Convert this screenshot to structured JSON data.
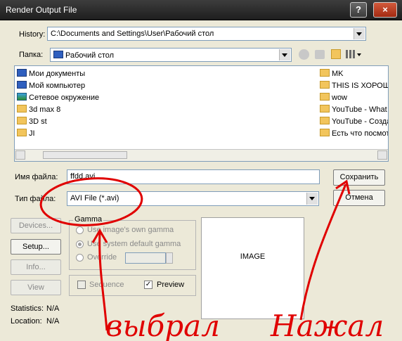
{
  "window": {
    "title": "Render Output File",
    "help_label": "?",
    "close_label": "×"
  },
  "history": {
    "label": "History:",
    "value": "C:\\Documents and Settings\\User\\Рабочий стол"
  },
  "folder": {
    "label": "Папка:",
    "value": "Рабочий стол"
  },
  "files": {
    "left": [
      {
        "label": "Мои документы",
        "icon": "documents-icon"
      },
      {
        "label": "Мой компьютер",
        "icon": "computer-icon"
      },
      {
        "label": "Сетевое окружение",
        "icon": "network-icon"
      },
      {
        "label": "3d max 8",
        "icon": "folder-icon"
      },
      {
        "label": "3D st",
        "icon": "folder-icon"
      },
      {
        "label": "JI",
        "icon": "folder-icon"
      }
    ],
    "right": [
      {
        "label": "MK",
        "icon": "folder-icon"
      },
      {
        "label": "THIS IS ХОРОШО",
        "icon": "folder-icon"
      },
      {
        "label": "wow",
        "icon": "folder-icon"
      },
      {
        "label": "YouTube - What",
        "icon": "folder-icon"
      },
      {
        "label": "YouTube - Созда",
        "icon": "folder-icon"
      },
      {
        "label": "Есть что посмот",
        "icon": "folder-icon"
      }
    ]
  },
  "filename": {
    "label": "Имя файла:",
    "value": "ffdd.avi"
  },
  "filetype": {
    "label": "Тип файла:",
    "value": "AVI File (*.avi)"
  },
  "buttons": {
    "save": "Сохранить",
    "cancel": "Отмена",
    "devices": "Devices...",
    "setup": "Setup...",
    "info": "Info...",
    "view": "View"
  },
  "gamma": {
    "title": "Gamma",
    "opt_own": "Use image's own gamma",
    "opt_system": "Use system default gamma",
    "opt_override": "Override",
    "override_value": ""
  },
  "sequence_label": "Sequence",
  "preview_label": "Preview",
  "image_label": "IMAGE",
  "statistics": {
    "label": "Statistics:",
    "value": "N/A"
  },
  "location": {
    "label": "Location:",
    "value": "N/A"
  },
  "annotations": {
    "left_text": "выбрал",
    "right_text": "Нажал",
    "color": "#e00000"
  }
}
